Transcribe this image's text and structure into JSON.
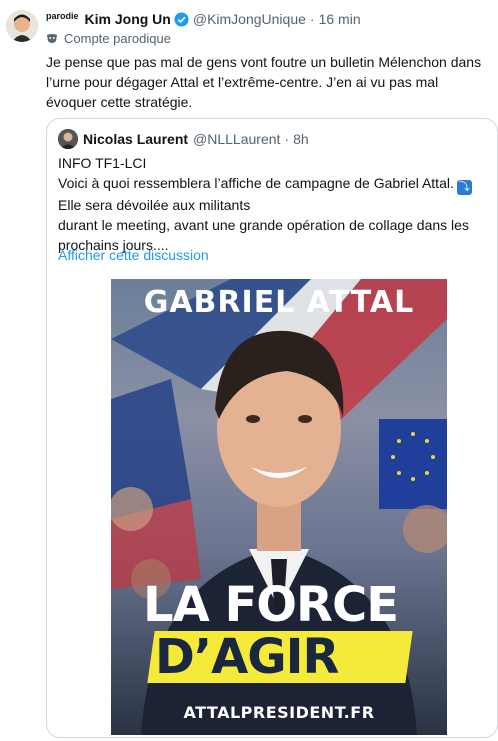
{
  "tweet": {
    "parody_label": "parodie",
    "author_name": "Kim Jong Un",
    "author_handle": "@KimJongUnique",
    "separator": "·",
    "time": "16 min",
    "account_label": "Compte parodique",
    "text": "Je pense que pas mal de gens vont foutre un bulletin Mélenchon dans l’urne pour dégager Attal et l’extrême-centre. J’en ai vu pas mal évoquer cette stratégie."
  },
  "quote": {
    "author_name": "Nicolas Laurent",
    "author_handle": "@NLLLaurent",
    "separator": "·",
    "time": "8h",
    "lines": [
      "INFO TF1-LCI",
      "Voici  à quoi ressemblera l’affiche de campagne de Gabriel Attal.",
      "Elle sera dévoilée aux militants",
      "durant le meeting, avant une grande opération de collage dans les prochains jours...."
    ],
    "show_more": "Afficher cette discussion"
  },
  "poster": {
    "title": "GABRIEL ATTAL",
    "slogan_line1": "LA FORCE",
    "slogan_line2": "D’AGIR",
    "url": "ATTALPRESIDENT.FR"
  },
  "colors": {
    "link": "#1d9bf0",
    "verified": "#1d9bf0",
    "secondary_text": "#536471",
    "poster_yellow": "#f5ea3a"
  },
  "icons": {
    "verified": "verified-badge-icon",
    "parody": "parody-mask-icon",
    "arrow": "arrow-down-right-emoji"
  }
}
